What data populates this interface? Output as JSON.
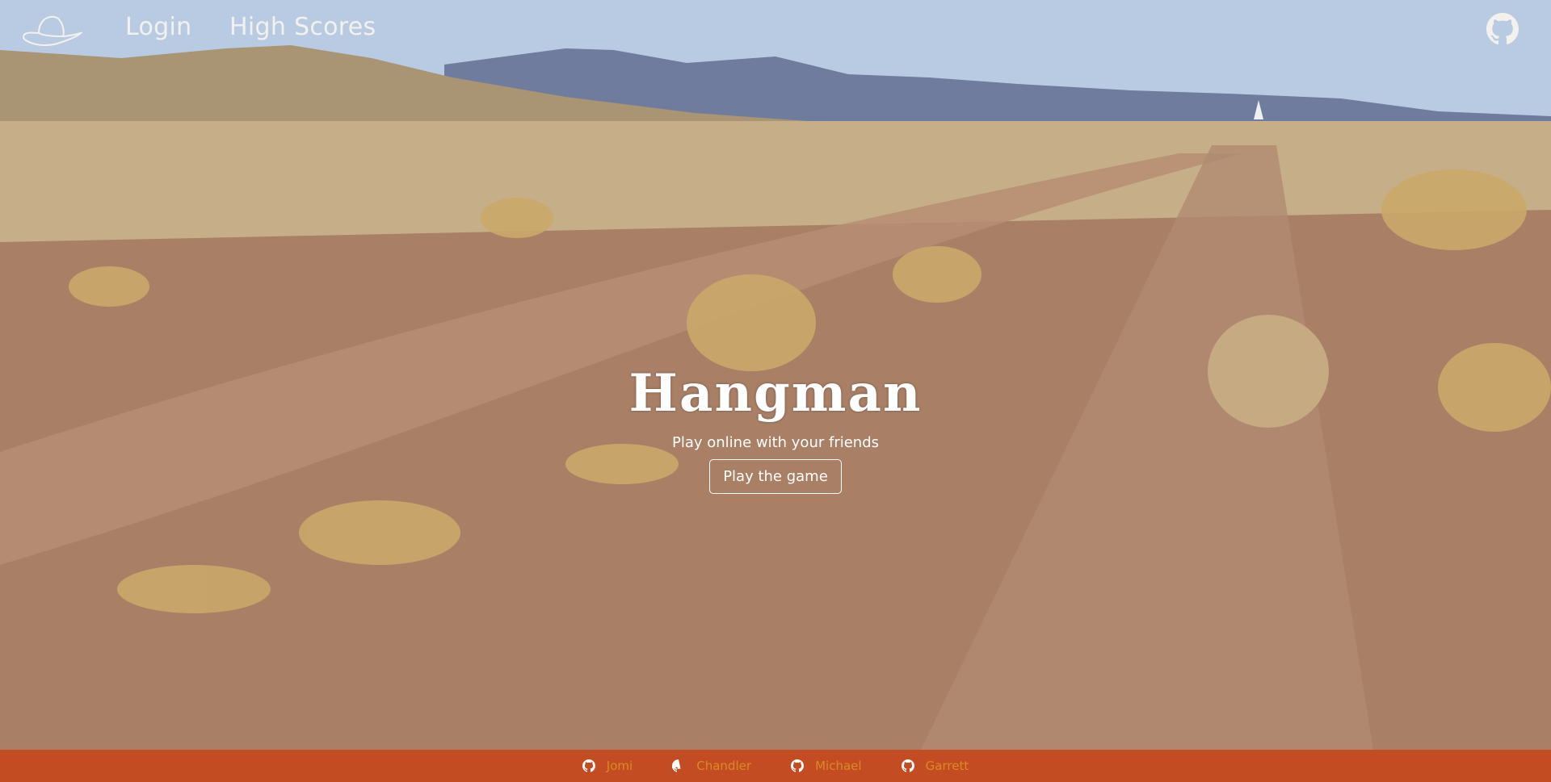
{
  "nav": {
    "login_label": "Login",
    "high_scores_label": "High Scores",
    "logo_icon": "cowboy-hat-icon",
    "github_icon": "github-icon"
  },
  "hero": {
    "title": "Hangman",
    "subtitle": "Play online with your friends",
    "play_label": "Play the game"
  },
  "footer": {
    "credits": [
      {
        "name": "Jomi",
        "icon": "github-icon"
      },
      {
        "name": "Chandler",
        "icon": "github-icon"
      },
      {
        "name": "Michael",
        "icon": "github-icon"
      },
      {
        "name": "Garrett",
        "icon": "github-icon"
      }
    ],
    "background": "#c44c23",
    "link_color": "#d98a26"
  }
}
